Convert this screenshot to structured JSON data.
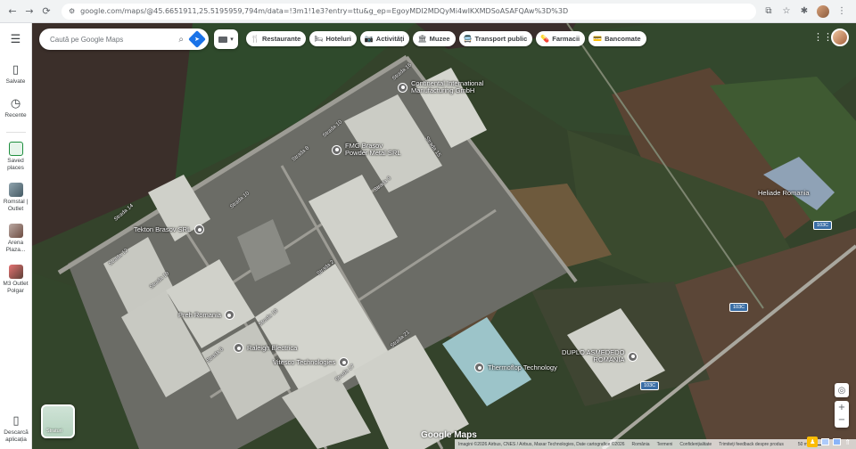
{
  "browser": {
    "url": "google.com/maps/@45.6651911,25.5195959,794m/data=!3m1!1e3?entry=ttu&g_ep=EgoyMDI2MDQyMi4wIKXMDSoASAFQAw%3D%3D",
    "nav_icons": [
      "←",
      "→",
      "⟳"
    ],
    "right_icons": [
      "⧉",
      "☆",
      "⋮"
    ]
  },
  "rail": {
    "items": [
      {
        "name": "menu",
        "icon": "☰",
        "label": ""
      },
      {
        "name": "saved",
        "icon": "🔖",
        "label": "Salvate"
      },
      {
        "name": "recent",
        "icon": "🕘",
        "label": "Recente"
      }
    ],
    "places": [
      {
        "label": "Saved places",
        "color": "#1e8e3e"
      },
      {
        "label": "Romstal | Outlet",
        "color": "#6d4c41"
      },
      {
        "label": "Arena Plaza...",
        "color": "#8d6e63"
      },
      {
        "label": "M3 Outlet Polgar",
        "color": "#5d4037"
      }
    ],
    "bottom": {
      "icon": "📱",
      "label": "Descarcă aplicația"
    }
  },
  "search": {
    "placeholder": "Caută pe Google Maps",
    "search_icon": "search-icon",
    "directions_icon": "directions-icon"
  },
  "layers": {
    "arrow": "▾"
  },
  "chips": [
    {
      "name": "restaurants",
      "icon": "🍴",
      "label": "Restaurante"
    },
    {
      "name": "hotels",
      "icon": "🛏",
      "label": "Hoteluri"
    },
    {
      "name": "activities",
      "icon": "📷",
      "label": "Activități"
    },
    {
      "name": "museums",
      "icon": "🏛",
      "label": "Muzee"
    },
    {
      "name": "transit",
      "icon": "🚍",
      "label": "Transport public"
    },
    {
      "name": "pharmacies",
      "icon": "💊",
      "label": "Farmacii"
    },
    {
      "name": "atms",
      "icon": "💳",
      "label": "Bancomate"
    }
  ],
  "map": {
    "places": [
      {
        "id": "continental",
        "label_lines": [
          "Continental International",
          "Manufacturing GmbH"
        ]
      },
      {
        "id": "fmg",
        "label_lines": [
          "FMG Brașov",
          "Powder Metal SRL"
        ]
      },
      {
        "id": "tekton",
        "label_lines": [
          "Tekton Brasov SRL"
        ]
      },
      {
        "id": "preh",
        "label_lines": [
          "Preh Romania"
        ]
      },
      {
        "id": "raiffeisen",
        "label_lines": [
          "Raleigh Electrica"
        ]
      },
      {
        "id": "vitesco",
        "label_lines": [
          "Vitesco Technologies"
        ]
      },
      {
        "id": "thermoflop",
        "label_lines": [
          "Thermoflop Technology"
        ]
      },
      {
        "id": "duplo",
        "label_lines": [
          "DUPLO ASMEDEDO",
          "ROMANIA"
        ]
      },
      {
        "id": "heliade",
        "label_lines": [
          "Heliade Romania"
        ]
      }
    ],
    "streets": [
      "Strada 16",
      "Strada 10",
      "Strada 8",
      "Strada 14",
      "Strada 12",
      "Strada 10",
      "Strada 15",
      "Strada 9",
      "Strada 2",
      "Strada 21",
      "Strada 17",
      "Strada 19",
      "Strada 6",
      "Strada 18"
    ],
    "roads": [
      "103C",
      "103C",
      "103C"
    ],
    "thumb_label": "Straturi",
    "logo": "Google Maps",
    "footer": [
      "Imagini ©2026 Airbus, CNES / Airbus, Maxar Technologies, Date cartografice ©2026",
      "România",
      "Termeni",
      "Confidențialitate",
      "Trimiteți feedback despre produs",
      "50 m"
    ]
  }
}
